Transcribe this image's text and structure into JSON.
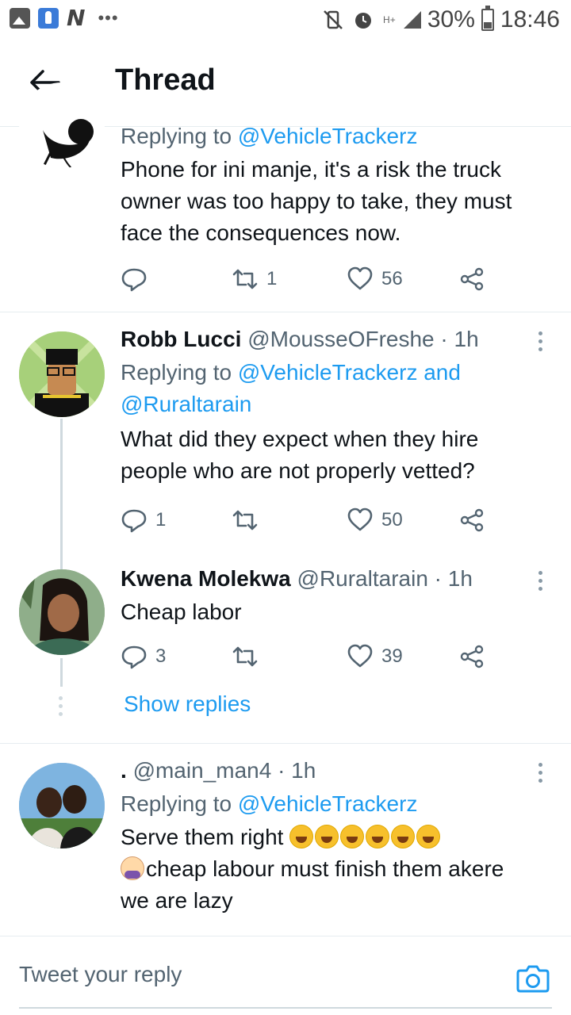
{
  "status_bar": {
    "battery": "30%",
    "time": "18:46",
    "network": "H+",
    "left_icons": [
      "gallery-icon",
      "rocket-icon",
      "n-app-icon"
    ],
    "overflow": "•••"
  },
  "header": {
    "title": "Thread",
    "back_icon": "arrow-left-icon"
  },
  "tweets": [
    {
      "reply_prefix": "Replying to",
      "reply_to": "@VehicleTrackerz",
      "text_lines": [
        "Phone for ini manje, it's a risk the truck",
        "owner was too happy to take, they must",
        "face the consequences now."
      ],
      "replies": "",
      "retweets": "1",
      "likes": "56"
    },
    {
      "name": "Robb Lucci",
      "handle": "@MousseOFreshe",
      "time": "· 1h",
      "reply_prefix": "Replying to",
      "reply_to": "@VehicleTrackerz",
      "reply_and": "and",
      "reply_to_2": "@Ruraltarain",
      "text_lines": [
        "What did they expect when they hire",
        "people who are not properly vetted?"
      ],
      "replies": "1",
      "retweets": "",
      "likes": "50"
    },
    {
      "name": "Kwena Molekwa",
      "handle": "@Ruraltarain",
      "time": "· 1h",
      "text": "Cheap labor",
      "replies": "3",
      "retweets": "",
      "likes": "39",
      "show_replies": "Show replies"
    },
    {
      "name": ".",
      "handle": "@main_man4",
      "time": "· 1h",
      "reply_prefix": "Replying to",
      "reply_to": "@VehicleTrackerz",
      "text_line1": "Serve them right",
      "text_line2": "cheap labour must finish them akere",
      "text_line3": "we are lazy"
    }
  ],
  "compose": {
    "placeholder": "Tweet your reply",
    "camera_icon": "camera-icon"
  },
  "colors": {
    "link": "#1d9bf0",
    "secondary_text": "#536471",
    "divider": "#e6ecf0"
  }
}
